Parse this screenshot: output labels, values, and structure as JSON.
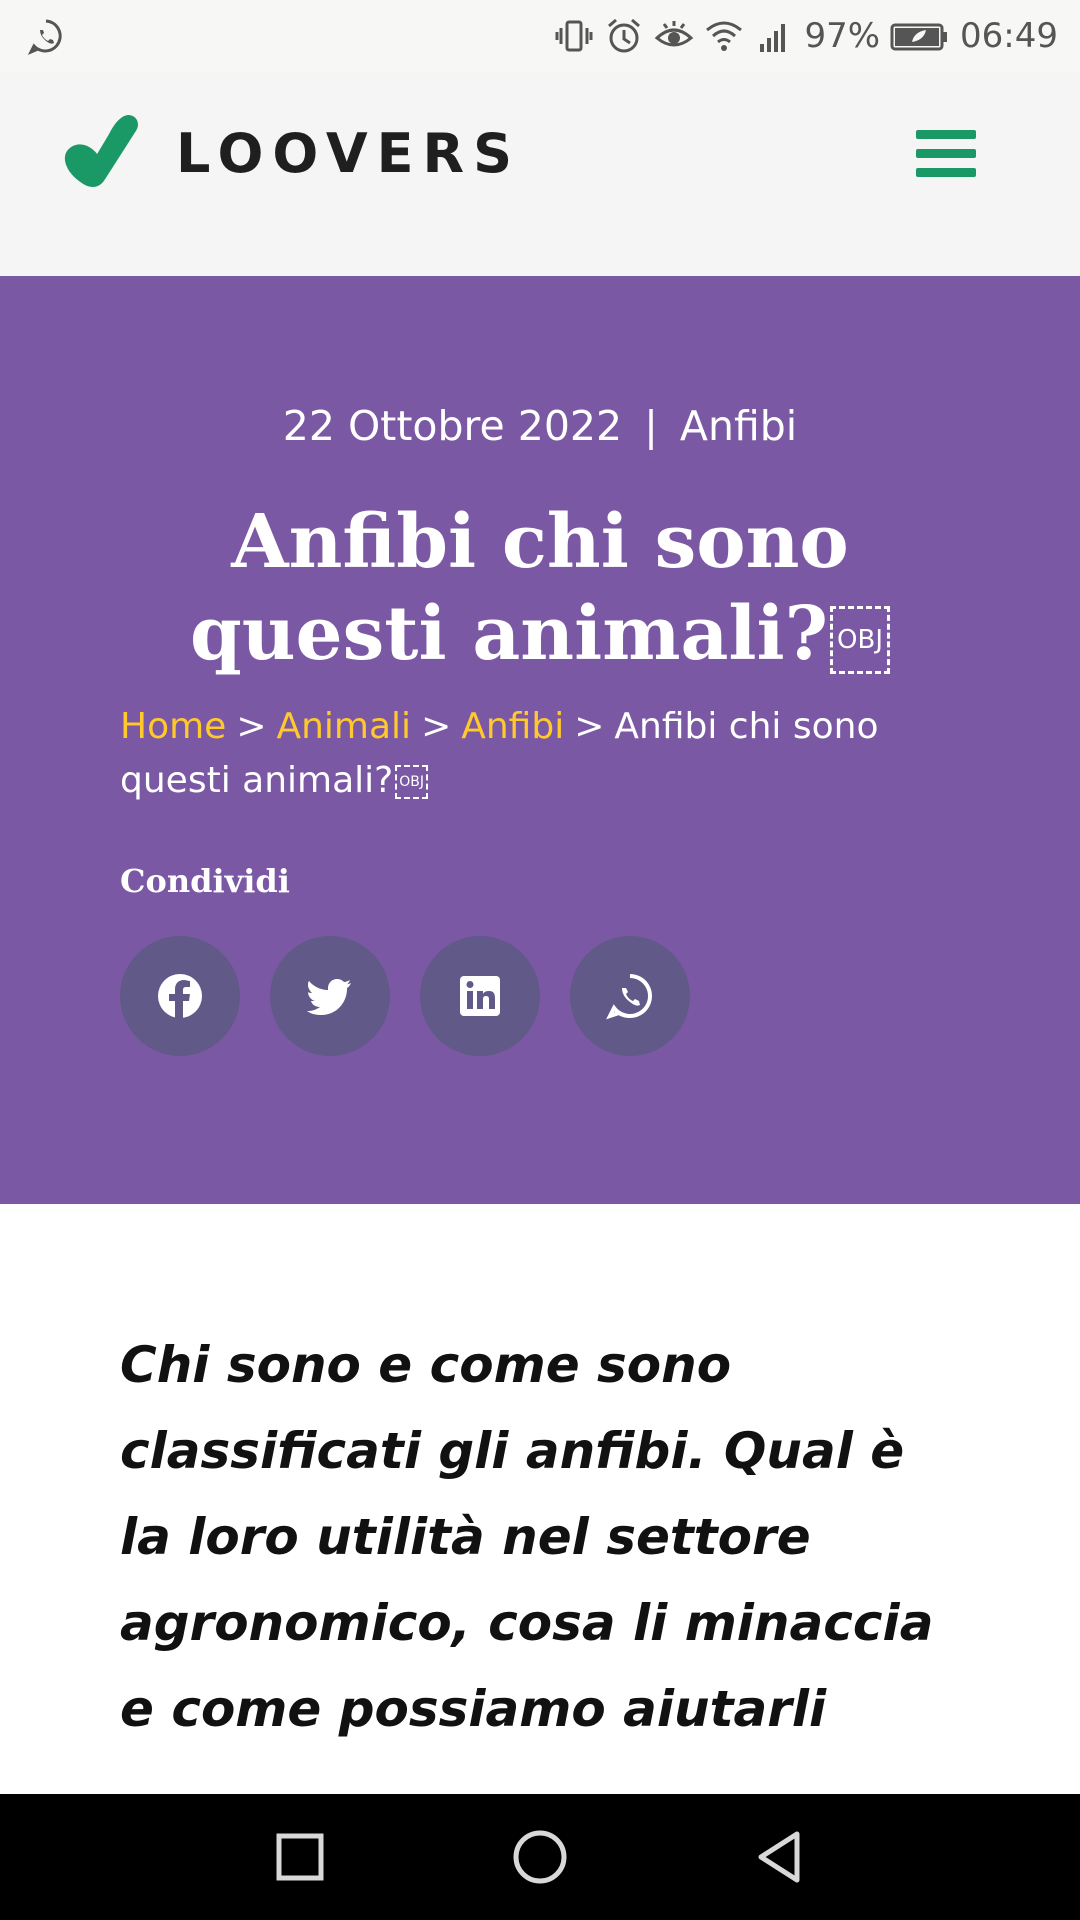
{
  "status_bar": {
    "battery_percent": "97%",
    "time": "06:49",
    "icons": [
      "whatsapp-notification-icon",
      "vibrate-icon",
      "alarm-icon",
      "eye-icon",
      "wifi-icon",
      "signal-icon",
      "battery-icon"
    ]
  },
  "header": {
    "brand": "LOOVERS",
    "accent_color": "#1a9966"
  },
  "hero": {
    "background_color": "#7b58a4",
    "date": "22 Ottobre 2022",
    "separator": "|",
    "category": "Anfibi",
    "title": "Anfibi chi sono questi animali?",
    "object_placeholder": "OBJ",
    "breadcrumb": {
      "items": [
        {
          "label": "Home",
          "link": true
        },
        {
          "label": "Animali",
          "link": true
        },
        {
          "label": "Anfibi",
          "link": true
        }
      ],
      "arrow": ">",
      "current": "Anfibi chi sono questi animali?",
      "link_color": "#ffc82c"
    },
    "share_label": "Condividi",
    "share_buttons": [
      {
        "icon": "facebook-icon"
      },
      {
        "icon": "twitter-icon"
      },
      {
        "icon": "linkedin-icon"
      },
      {
        "icon": "whatsapp-icon"
      }
    ]
  },
  "intro": {
    "text": "Chi sono e come sono classificati gli anfibi. Qual è la loro utilità nel settore agronomico, cosa li minaccia e come possiamo aiutarli"
  },
  "nav_bar": {
    "buttons": [
      "recent-apps-icon",
      "home-icon",
      "back-icon"
    ]
  }
}
